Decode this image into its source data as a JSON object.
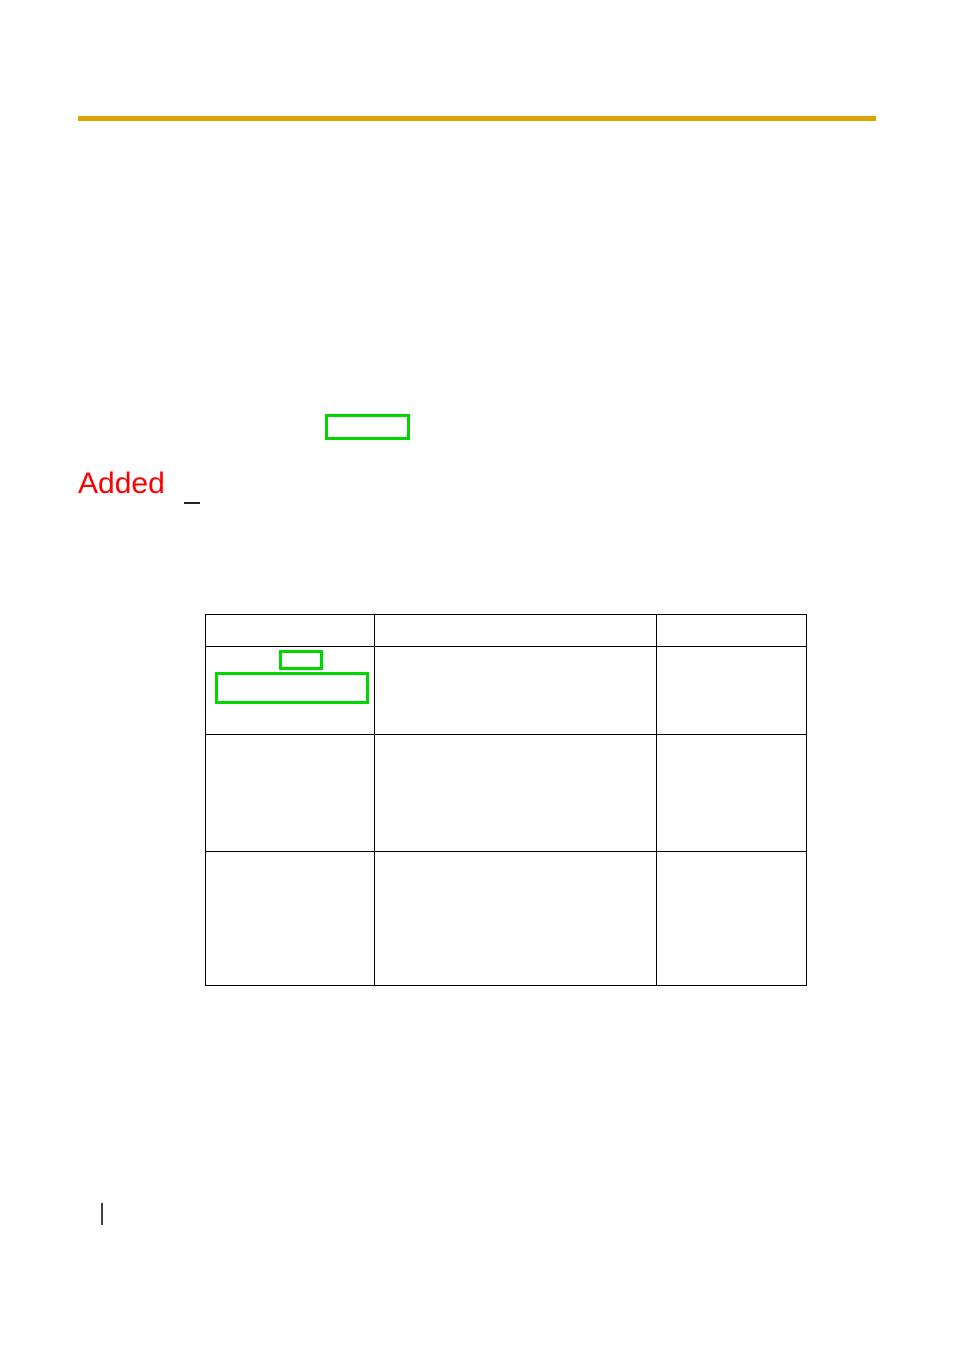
{
  "annotations": {
    "added_label": "Added"
  },
  "colors": {
    "rule": "#d8a607",
    "highlight_border": "#00d600",
    "added_text": "#ff0000"
  },
  "table": {
    "rows": 4,
    "cols": 3,
    "cells": [
      [
        "",
        "",
        ""
      ],
      [
        "",
        "",
        ""
      ],
      [
        "",
        "",
        ""
      ],
      [
        "",
        "",
        ""
      ]
    ]
  }
}
